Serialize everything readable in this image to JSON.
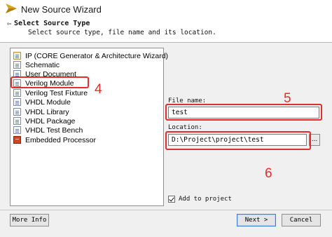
{
  "window": {
    "title": "New Source Wizard"
  },
  "header": {
    "back_glyph": "⇦",
    "title": "Select Source Type",
    "subtitle": "Select source type, file name and its location."
  },
  "source_types": [
    {
      "label": "IP (CORE Generator & Architecture Wizard)",
      "icon": "ip-core-icon"
    },
    {
      "label": "Schematic",
      "icon": "schematic-icon"
    },
    {
      "label": "User Document",
      "icon": "document-icon"
    },
    {
      "label": "Verilog Module",
      "icon": "verilog-icon",
      "selected": true
    },
    {
      "label": "Verilog Test Fixture",
      "icon": "verilog-test-icon"
    },
    {
      "label": "VHDL Module",
      "icon": "vhdl-icon"
    },
    {
      "label": "VHDL Library",
      "icon": "vhdl-library-icon"
    },
    {
      "label": "VHDL Package",
      "icon": "vhdl-package-icon"
    },
    {
      "label": "VHDL Test Bench",
      "icon": "vhdl-testbench-icon"
    },
    {
      "label": "Embedded Processor",
      "icon": "processor-icon"
    }
  ],
  "form": {
    "file_name_label": "File name:",
    "file_name_value": "test",
    "location_label": "Location:",
    "location_value": "D:\\Project\\project\\test",
    "browse_label": "...",
    "add_to_project_label": "Add to project",
    "add_to_project_checked": true
  },
  "buttons": {
    "more_info": "More Info",
    "next": "Next >",
    "cancel": "Cancel"
  },
  "annotations": {
    "step4": "4",
    "step5": "5",
    "step6": "6"
  },
  "colors": {
    "annotation_red": "#e52d2d",
    "focus_blue": "#3e7bd8"
  }
}
